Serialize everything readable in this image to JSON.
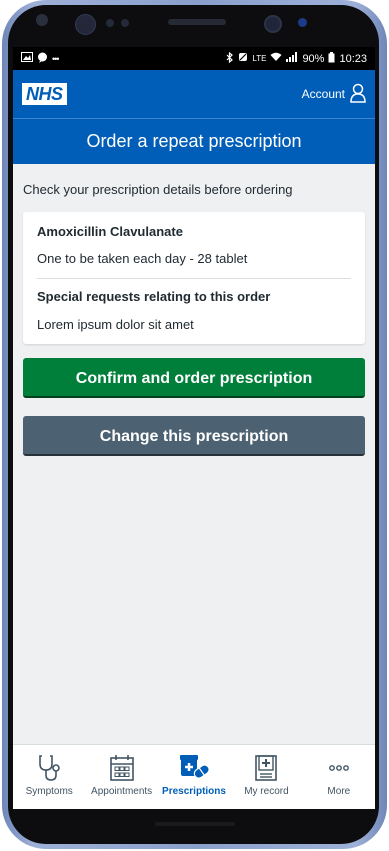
{
  "status_bar": {
    "left_icons": [
      "image-icon",
      "chat-bubble-icon",
      "ellipsis-icon"
    ],
    "network": "LTE",
    "battery": "90%",
    "time": "10:23"
  },
  "header": {
    "logo": "NHS",
    "account_label": "Account",
    "title": "Order a repeat prescription"
  },
  "main": {
    "intro": "Check your prescription details before ordering",
    "prescription": {
      "name": "Amoxicillin Clavulanate",
      "dosage": "One to be taken each day - 28 tablet",
      "requests_heading": "Special requests relating to this order",
      "requests_text": "Lorem ipsum dolor sit amet"
    },
    "confirm_label": "Confirm and order prescription",
    "change_label": "Change this prescription"
  },
  "tabs": [
    {
      "label": "Symptoms",
      "icon": "stethoscope-icon",
      "active": false
    },
    {
      "label": "Appointments",
      "icon": "calendar-icon",
      "active": false
    },
    {
      "label": "Prescriptions",
      "icon": "pills-icon",
      "active": true
    },
    {
      "label": "My record",
      "icon": "medical-record-icon",
      "active": false
    },
    {
      "label": "More",
      "icon": "more-dots-icon",
      "active": false
    }
  ],
  "colors": {
    "nhs_blue": "#005eb8",
    "confirm_green": "#007f3b",
    "secondary_grey": "#4c6272",
    "background": "#eef0f2"
  }
}
